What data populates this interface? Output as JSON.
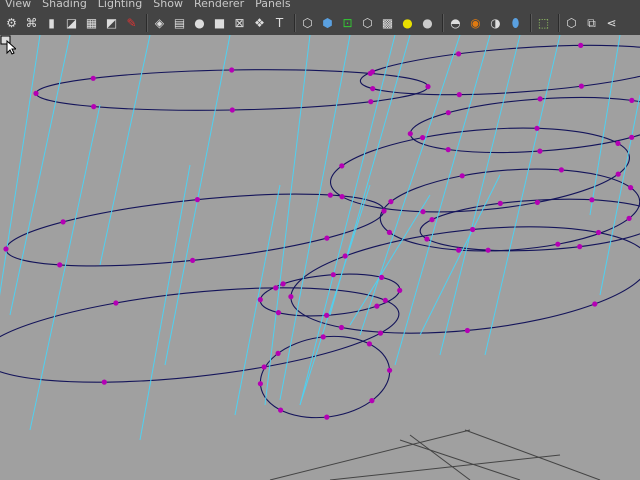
{
  "menu": [
    "View",
    "Shading",
    "Lighting",
    "Show",
    "Renderer",
    "Panels"
  ],
  "toolbar": {
    "groups": [
      [
        {
          "name": "select-camera-icon",
          "glyph": "⚙",
          "interactable": true
        },
        {
          "name": "camera-attributes-icon",
          "glyph": "⌘",
          "interactable": true
        },
        {
          "name": "bookmarks-icon",
          "glyph": "▮",
          "interactable": true
        },
        {
          "name": "image-plane-icon",
          "glyph": "◪",
          "interactable": true
        },
        {
          "name": "grid-icon",
          "glyph": "▦",
          "interactable": true
        },
        {
          "name": "film-gate-icon",
          "glyph": "◩",
          "interactable": true
        },
        {
          "name": "resolution-gate-icon",
          "glyph": "✎",
          "interactable": true
        }
      ],
      [
        {
          "name": "wireframe-icon",
          "glyph": "◈",
          "interactable": true
        },
        {
          "name": "wireframe-on-shaded-icon",
          "glyph": "▤",
          "interactable": true
        },
        {
          "name": "smooth-shade-icon",
          "glyph": "●",
          "interactable": true
        },
        {
          "name": "flat-shade-icon",
          "glyph": "■",
          "interactable": true
        },
        {
          "name": "bounding-box-icon",
          "glyph": "⊠",
          "interactable": true
        },
        {
          "name": "use-default-material-icon",
          "glyph": "❖",
          "interactable": true
        },
        {
          "name": "textured-icon",
          "glyph": "T",
          "interactable": true
        }
      ],
      [
        {
          "name": "isolate-select-icon",
          "glyph": "⬡",
          "interactable": true
        },
        {
          "name": "xray-icon",
          "glyph": "⬢",
          "interactable": true
        },
        {
          "name": "xray-joints-icon",
          "glyph": "⊡",
          "interactable": true
        },
        {
          "name": "xray-components-icon",
          "glyph": "⬡",
          "interactable": true
        },
        {
          "name": "checker-icon",
          "glyph": "▩",
          "interactable": true
        },
        {
          "name": "use-all-lights-icon",
          "glyph": "●",
          "interactable": true
        },
        {
          "name": "shadows-icon",
          "glyph": "●",
          "interactable": true
        }
      ],
      [
        {
          "name": "screen-space-ao-icon",
          "glyph": "◓",
          "interactable": true
        },
        {
          "name": "motion-blur-icon",
          "glyph": "◉",
          "interactable": true
        },
        {
          "name": "multisample-aa-icon",
          "glyph": "◑",
          "interactable": true
        },
        {
          "name": "depth-of-field-icon",
          "glyph": "⬮",
          "interactable": true
        }
      ],
      [
        {
          "name": "select-tool-icon",
          "glyph": "⬚",
          "interactable": true
        }
      ],
      [
        {
          "name": "hud-icon",
          "glyph": "⬡",
          "interactable": true
        },
        {
          "name": "panel-layout-icon",
          "glyph": "⧉",
          "interactable": true
        },
        {
          "name": "share-icon",
          "glyph": "⋖",
          "interactable": true
        }
      ]
    ]
  },
  "colors": {
    "viewport_bg": "#a0a0a0",
    "curve": "#14145a",
    "hull": "#4fd0f0",
    "cv_point": "#b400b4",
    "grid": "#444444"
  }
}
